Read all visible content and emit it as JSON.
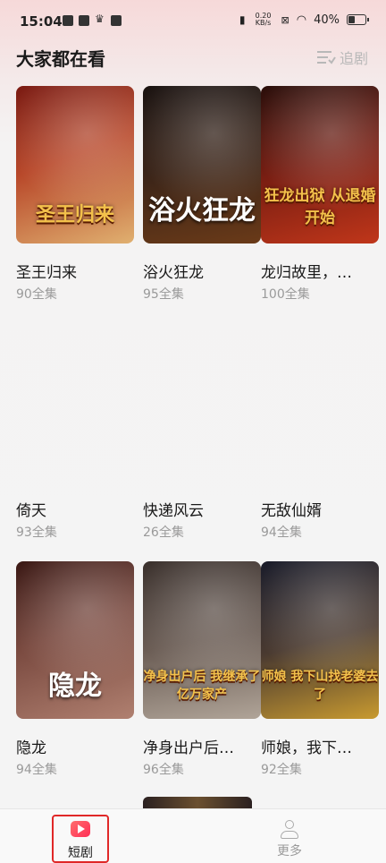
{
  "status_bar": {
    "time": "15:04",
    "net_speed_value": "0.20",
    "net_speed_unit": "KB/s",
    "battery": "40%"
  },
  "section": {
    "title": "大家都在看",
    "follow_label": "追剧"
  },
  "dramas": [
    {
      "title": "圣王归来",
      "episodes": "90全集",
      "poster_text": "圣王归来",
      "poster_colors": [
        "#7a1a12",
        "#e0b070"
      ]
    },
    {
      "title": "浴火狂龙",
      "episodes": "95全集",
      "poster_text": "浴火狂龙",
      "poster_colors": [
        "#1a1210",
        "#6a3a18"
      ]
    },
    {
      "title": "龙归故里，…",
      "episodes": "100全集",
      "poster_text": "狂龙出狱 从退婚开始",
      "poster_colors": [
        "#2a0e0a",
        "#c0361a"
      ]
    },
    {
      "title": "倚天",
      "episodes": "93全集"
    },
    {
      "title": "快递风云",
      "episodes": "26全集"
    },
    {
      "title": "无敌仙婿",
      "episodes": "94全集"
    },
    {
      "title": "隐龙",
      "episodes": "94全集",
      "poster_text": "隐龙",
      "poster_colors": [
        "#3a1814",
        "#b08070"
      ]
    },
    {
      "title": "净身出户后…",
      "episodes": "96全集",
      "poster_text": "净身出户后 我继承了亿万家产",
      "poster_colors": [
        "#3a302c",
        "#b0a498"
      ]
    },
    {
      "title": "师娘，我下…",
      "episodes": "92全集",
      "poster_text": "师娘 我下山找老婆去了",
      "poster_colors": [
        "#1a1c2a",
        "#c89a30"
      ]
    }
  ],
  "bottom_nav": {
    "short_drama": "短剧",
    "more": "更多"
  }
}
